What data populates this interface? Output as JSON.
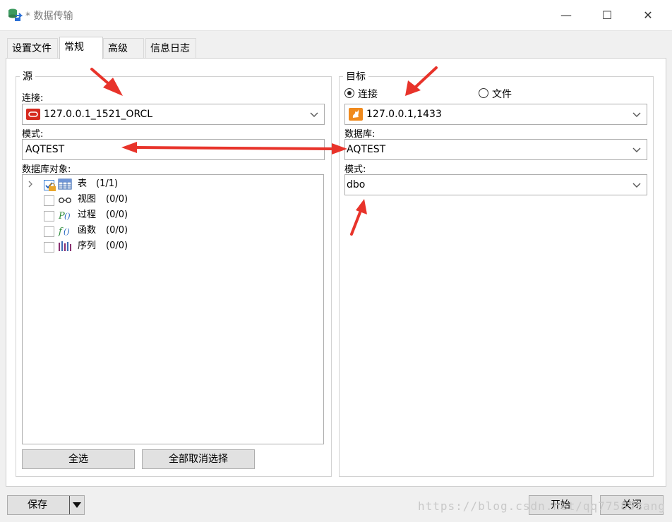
{
  "window": {
    "title": "* 数据传输",
    "icon": "data-transfer-icon",
    "controls": {
      "minimize": "—",
      "maximize": "☐",
      "close": "✕"
    }
  },
  "tabs": [
    {
      "label": "设置文件",
      "active": false
    },
    {
      "label": "常规",
      "active": true
    },
    {
      "label": "高级",
      "active": false
    },
    {
      "label": "信息日志",
      "active": false
    }
  ],
  "source": {
    "group_title": "源",
    "connection_label": "连接:",
    "connection_value": "127.0.0.1_1521_ORCL",
    "connection_icon": "oracle-icon",
    "schema_label": "模式:",
    "schema_value": "AQTEST",
    "objects_label": "数据库对象:",
    "objects": [
      {
        "name": "表",
        "count": "(1/1)",
        "icon": "table-icon",
        "checked": true
      },
      {
        "name": "视图",
        "count": "(0/0)",
        "icon": "view-icon",
        "checked": false
      },
      {
        "name": "过程",
        "count": "(0/0)",
        "icon": "procedure-icon",
        "checked": false
      },
      {
        "name": "函数",
        "count": "(0/0)",
        "icon": "function-icon",
        "checked": false
      },
      {
        "name": "序列",
        "count": "(0/0)",
        "icon": "sequence-icon",
        "checked": false
      }
    ],
    "select_all": "全选",
    "deselect_all": "全部取消选择"
  },
  "target": {
    "group_title": "目标",
    "radio_connection": "连接",
    "radio_file": "文件",
    "connection_value": "127.0.0.1,1433",
    "connection_icon": "sqlserver-icon",
    "database_label": "数据库:",
    "database_value": "AQTEST",
    "schema_label": "模式:",
    "schema_value": "dbo"
  },
  "footer": {
    "save": "保存",
    "start": "开始",
    "close": "关闭"
  },
  "watermark": "https://blog.csdn.net/qq775858ang",
  "colors": {
    "annotation_red": "#e8332a",
    "oracle_red": "#d62a1f",
    "sqlserver_orange": "#f08a1d"
  }
}
